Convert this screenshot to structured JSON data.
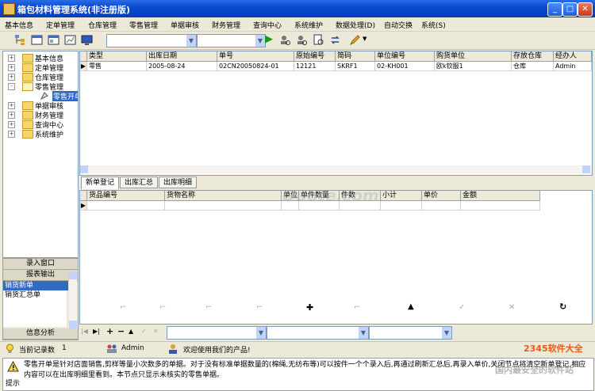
{
  "window": {
    "title": "箱包材料管理系统(非注册版)",
    "minimize": "_",
    "maximize": "□",
    "close": "✕"
  },
  "menu": [
    "基本信息",
    "定单管理",
    "仓库管理",
    "零售管理",
    "单据审核",
    "财务管理",
    "查询中心",
    "系统维护",
    "数据处理(D)",
    "自动交换",
    "系统(S)"
  ],
  "toolbar": {
    "combo1": "",
    "combo2": "",
    "combo3": "",
    "play": "▶"
  },
  "tree": {
    "items": [
      {
        "label": "基本信息",
        "expander": "+"
      },
      {
        "label": "定单管理",
        "expander": "+"
      },
      {
        "label": "仓库管理",
        "expander": "+"
      },
      {
        "label": "零售管理",
        "expander": "-"
      },
      {
        "label": "零售开单",
        "expander": ""
      },
      {
        "label": "单据审核",
        "expander": "+"
      },
      {
        "label": "财务管理",
        "expander": "+"
      },
      {
        "label": "查询中心",
        "expander": "+"
      },
      {
        "label": "系统维护",
        "expander": "+"
      }
    ]
  },
  "leftnav": {
    "buttons": [
      "录入窗口",
      "报表输出"
    ],
    "items": [
      "销货新单",
      "销货汇总单"
    ],
    "bottom": "信息分析"
  },
  "top_grid": {
    "columns": [
      "类型",
      "出库日期",
      "单号",
      "原始编号",
      "简码",
      "单位编号",
      "购货单位",
      "存放仓库",
      "经办人"
    ],
    "rows": [
      [
        "零售",
        "2005-08-24",
        "02CN20050824-01",
        "12121",
        "SKRF1",
        "02-KH001",
        "欧k钦服1",
        "仓库",
        "Admin"
      ]
    ],
    "row_marker": "▶"
  },
  "tabs": [
    "新单登记",
    "出库汇总",
    "出库明细"
  ],
  "bottom_grid": {
    "columns": [
      "货品编号",
      "货物名称",
      "单位",
      "单件数量",
      "件数",
      "小计",
      "单价",
      "金额"
    ],
    "row_marker": "▶"
  },
  "nav_strip": {
    "first": "|◀",
    "last": "▶|",
    "add": "+",
    "delete": "−",
    "up": "▲",
    "confirm": "✓",
    "cancel": "✕",
    "plus2": "✚",
    "up2": "▲",
    "refresh": "↻"
  },
  "status": {
    "records_label": "当前记录数",
    "records_value": "1",
    "user": "Admin",
    "welcome": "欢迎使用我们的产品!"
  },
  "info": {
    "label": "提示",
    "text": "零售开单是针对店面销售,剪样等量小次数多的单据。对于没有标准单据数量的(棉绳,无纺布等)可以按件一个个录入后,再通过刷新汇总后,再录入单价,关闭节点将清空新单登记,相应内容可以在出库明细里看到。本节点只显示未核实的零售单据。"
  },
  "watermarks": {
    "w1": "Duote.com",
    "w2": "2345软件大全",
    "w3": "国内最安全的软件站",
    "w4": "www.DuoTe.com"
  },
  "colors": {
    "title_blue": "#0a4ad0",
    "selection": "#316ac5",
    "window_bg": "#ece9d8"
  }
}
